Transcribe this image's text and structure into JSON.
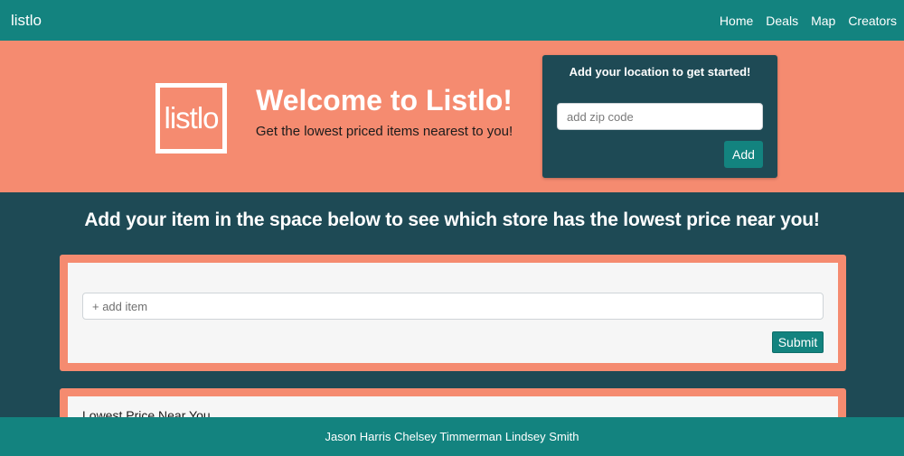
{
  "navbar": {
    "brand": "listlo",
    "links": [
      "Home",
      "Deals",
      "Map",
      "Creators"
    ]
  },
  "hero": {
    "logo_text": "listlo",
    "title": "Welcome to Listlo!",
    "subtitle": "Get the lowest priced items nearest to you!"
  },
  "location": {
    "title": "Add your location to get started!",
    "zip_placeholder": "add zip code",
    "zip_value": "",
    "add_label": "Add"
  },
  "main": {
    "heading": "Add your item in the space below to see which store has the lowest price near you!",
    "item_placeholder": "+ add item",
    "item_value": "",
    "submit_label": "Submit",
    "results_title": "Lowest Price Near You"
  },
  "footer": {
    "creators": "Jason Harris Chelsey Timmerman Lindsey Smith"
  },
  "colors": {
    "teal": "#13837f",
    "dark_teal": "#1e4a55",
    "salmon": "#f58b70"
  }
}
